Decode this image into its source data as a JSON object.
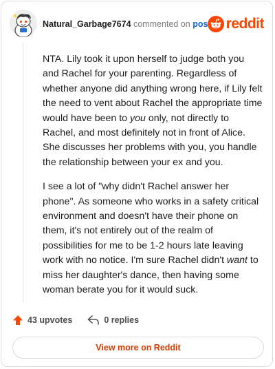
{
  "header": {
    "username": "Natural_Garbage7674",
    "action": "commented on",
    "post_link": "post",
    "logo_text": "reddit",
    "avatar_icon": "snoo-avatar-icon",
    "brand_color": "#ff4500"
  },
  "comment": {
    "p1_a": "NTA. Lily took it upon herself to judge both you and Rachel for your parenting. Regardless of whether anyone did anything wrong here, if Lily felt the need to vent about Rachel the appropriate time would have been to ",
    "p1_em": "you",
    "p1_b": " only, not directly to Rachel, and most definitely not in front of Alice. She discusses her problems with you, you handle the relationship between your ex and you.",
    "p2_a": "I see a lot of \"why didn't Rachel answer her phone\". As someone who works in a safety critical environment and doesn't have their phone on them, it's not entirely out of the realm of possibilities for me to be 1-2 hours late leaving work with no notice. I'm sure Rachel didn't ",
    "p2_em": "want",
    "p2_b": " to miss her daughter's dance, then having some woman berate you for it would suck."
  },
  "actions": {
    "upvotes": "43 upvotes",
    "replies": "0 replies",
    "upvote_icon": "upvote-arrow-icon",
    "reply_icon": "reply-arrow-icon"
  },
  "footer": {
    "view_more": "View more on Reddit"
  }
}
